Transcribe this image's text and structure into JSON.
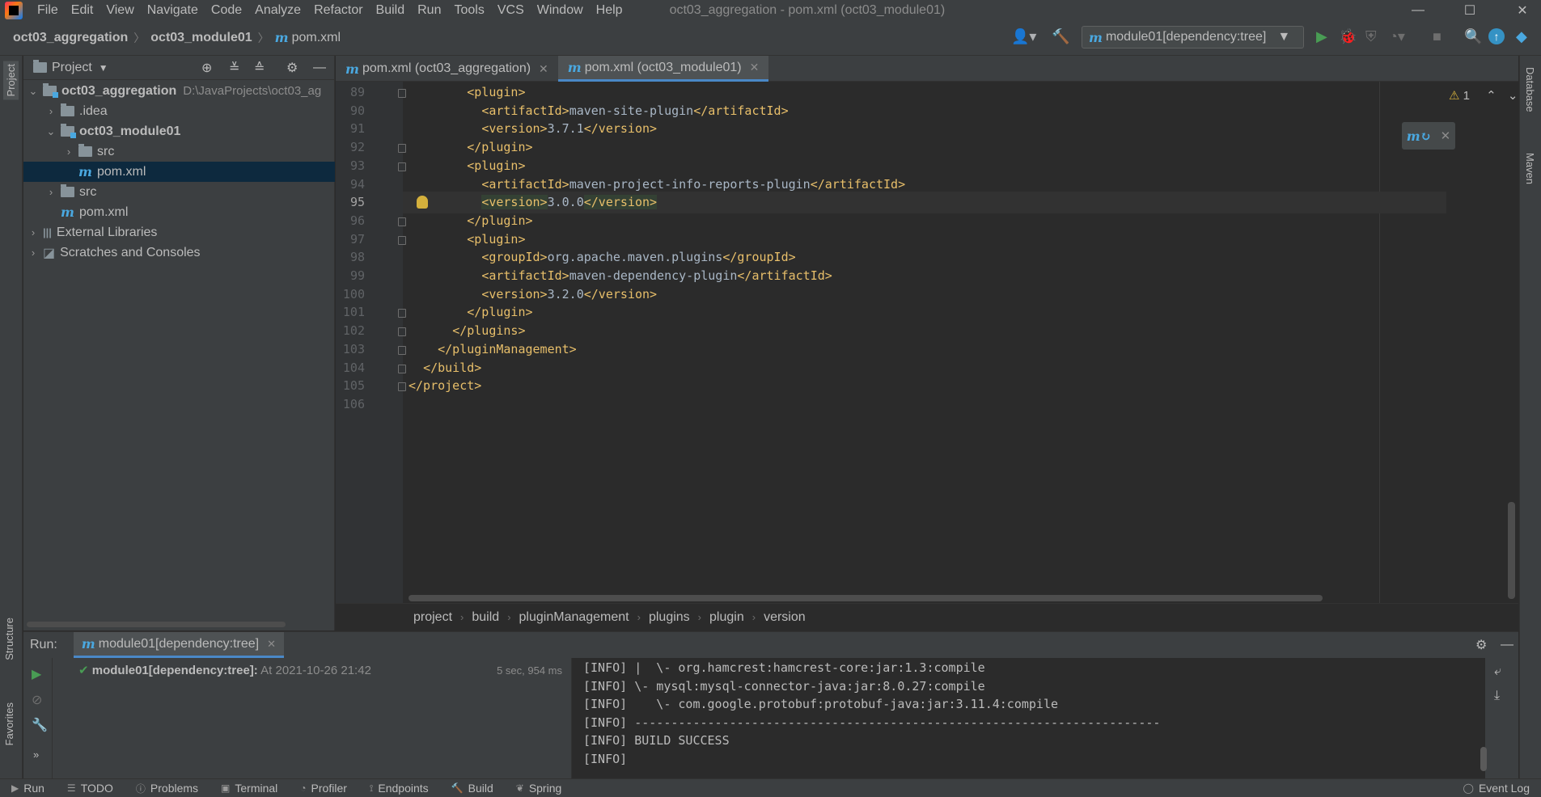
{
  "menu": {
    "items": [
      "File",
      "Edit",
      "View",
      "Navigate",
      "Code",
      "Analyze",
      "Refactor",
      "Build",
      "Run",
      "Tools",
      "VCS",
      "Window",
      "Help"
    ],
    "window_title": "oct03_aggregation - pom.xml (oct03_module01)"
  },
  "navbar": {
    "crumbs": [
      "oct03_aggregation",
      "oct03_module01",
      "pom.xml"
    ],
    "run_config": "module01[dependency:tree]"
  },
  "project": {
    "title": "Project",
    "tree": [
      {
        "label": "oct03_aggregation",
        "path": "D:\\JavaProjects\\oct03_ag",
        "level": 0,
        "expanded": true,
        "kind": "module",
        "bold": true
      },
      {
        "label": ".idea",
        "level": 1,
        "expanded": false,
        "kind": "folder"
      },
      {
        "label": "oct03_module01",
        "level": 1,
        "expanded": true,
        "kind": "module",
        "bold": true
      },
      {
        "label": "src",
        "level": 2,
        "expanded": false,
        "kind": "folder"
      },
      {
        "label": "pom.xml",
        "level": 2,
        "kind": "maven",
        "selected": true
      },
      {
        "label": "src",
        "level": 1,
        "expanded": false,
        "kind": "folder"
      },
      {
        "label": "pom.xml",
        "level": 1,
        "kind": "maven"
      },
      {
        "label": "External Libraries",
        "level": 0,
        "expanded": false,
        "kind": "lib"
      },
      {
        "label": "Scratches and Consoles",
        "level": 0,
        "expanded": false,
        "kind": "scratch"
      }
    ]
  },
  "editor": {
    "tabs": [
      {
        "label": "pom.xml (oct03_aggregation)",
        "active": false
      },
      {
        "label": "pom.xml (oct03_module01)",
        "active": true
      }
    ],
    "lines": [
      {
        "num": "89",
        "indent": 4,
        "open": "<plugin>",
        "text": "",
        "close": ""
      },
      {
        "num": "90",
        "indent": 5,
        "open": "<artifactId>",
        "text": "maven-site-plugin",
        "close": "</artifactId>"
      },
      {
        "num": "91",
        "indent": 5,
        "open": "<version>",
        "text": "3.7.1",
        "close": "</version>"
      },
      {
        "num": "92",
        "indent": 4,
        "open": "</plugin>",
        "text": "",
        "close": ""
      },
      {
        "num": "93",
        "indent": 4,
        "open": "<plugin>",
        "text": "",
        "close": ""
      },
      {
        "num": "94",
        "indent": 5,
        "open": "<artifactId>",
        "text": "maven-project-info-reports-plugin",
        "close": "</artifactId>"
      },
      {
        "num": "95",
        "indent": 5,
        "open": "<version>",
        "text": "3.0.0",
        "close": "</version>",
        "current": true
      },
      {
        "num": "96",
        "indent": 4,
        "open": "</plugin>",
        "text": "",
        "close": ""
      },
      {
        "num": "97",
        "indent": 4,
        "open": "<plugin>",
        "text": "",
        "close": ""
      },
      {
        "num": "98",
        "indent": 5,
        "open": "<groupId>",
        "text": "org.apache.maven.plugins",
        "close": "</groupId>"
      },
      {
        "num": "99",
        "indent": 5,
        "open": "<artifactId>",
        "text": "maven-dependency-plugin",
        "close": "</artifactId>"
      },
      {
        "num": "100",
        "indent": 5,
        "open": "<version>",
        "text": "3.2.0",
        "close": "</version>"
      },
      {
        "num": "101",
        "indent": 4,
        "open": "</plugin>",
        "text": "",
        "close": ""
      },
      {
        "num": "102",
        "indent": 3,
        "open": "</plugins>",
        "text": "",
        "close": ""
      },
      {
        "num": "103",
        "indent": 2,
        "open": "</pluginManagement>",
        "text": "",
        "close": ""
      },
      {
        "num": "104",
        "indent": 1,
        "open": "</build>",
        "text": "",
        "close": ""
      },
      {
        "num": "105",
        "indent": 0,
        "open": "</project>",
        "text": "",
        "close": ""
      },
      {
        "num": "106",
        "indent": 0,
        "open": "",
        "text": "",
        "close": ""
      }
    ],
    "warning_count": "1",
    "breadcrumb": [
      "project",
      "build",
      "pluginManagement",
      "plugins",
      "plugin",
      "version"
    ]
  },
  "run": {
    "label": "Run:",
    "tab": "module01[dependency:tree]",
    "tree_item": "module01[dependency:tree]:",
    "tree_item_time": "At 2021-10-26 21:42",
    "duration": "5 sec, 954 ms",
    "console": [
      "[INFO] |  \\- org.hamcrest:hamcrest-core:jar:1.3:compile",
      "[INFO] \\- mysql:mysql-connector-java:jar:8.0.27:compile",
      "[INFO]    \\- com.google.protobuf:protobuf-java:jar:3.11.4:compile",
      "[INFO] ------------------------------------------------------------------------",
      "[INFO] BUILD SUCCESS",
      "[INFO] "
    ]
  },
  "side_tabs": {
    "left_top": "Project",
    "left_mid": "Structure",
    "left_bottom": "Favorites",
    "right_top": "Database",
    "right_mid": "Maven"
  },
  "statusbar": {
    "items": [
      "Run",
      "TODO",
      "Problems",
      "Terminal",
      "Profiler",
      "Endpoints",
      "Build",
      "Spring"
    ],
    "event_log": "Event Log"
  },
  "colors": {
    "accent": "#4a88c7",
    "tag": "#e8bf6a",
    "run_green": "#499c54",
    "maven_blue": "#4aa8e0"
  }
}
